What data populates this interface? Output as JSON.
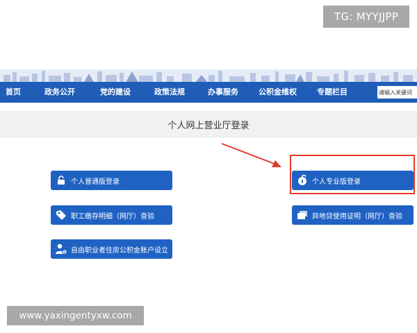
{
  "watermark_top": "TG: MYYJJPP",
  "nav": {
    "items": [
      "首页",
      "政务公开",
      "党的建设",
      "政策法规",
      "办事服务",
      "公积金维权",
      "专题栏目"
    ],
    "search_placeholder": "请输入关键词"
  },
  "page_title": "个人网上营业厅登录",
  "buttons": {
    "personal_normal_login": "个人普通版登录",
    "employee_deposit_query": "职工缴存明细（网厅）查验",
    "freelancer_account_open": "自由职业者住房公积金账户设立",
    "personal_pro_login": "个人专业版登录",
    "offsite_loan_query": "异地贷使用证明（网厅）查验"
  },
  "colors": {
    "nav_bg": "#1f5db8",
    "button_bg": "#1f62c3",
    "highlight": "#e23a2a"
  },
  "icons": {
    "personal_normal_login": "unlock-icon",
    "employee_deposit_query": "tag-icon",
    "freelancer_account_open": "user-gear-icon",
    "personal_pro_login": "unlock-icon",
    "offsite_loan_query": "document-stack-icon"
  },
  "watermark_bottom": "www.yaxingentyxw.com"
}
